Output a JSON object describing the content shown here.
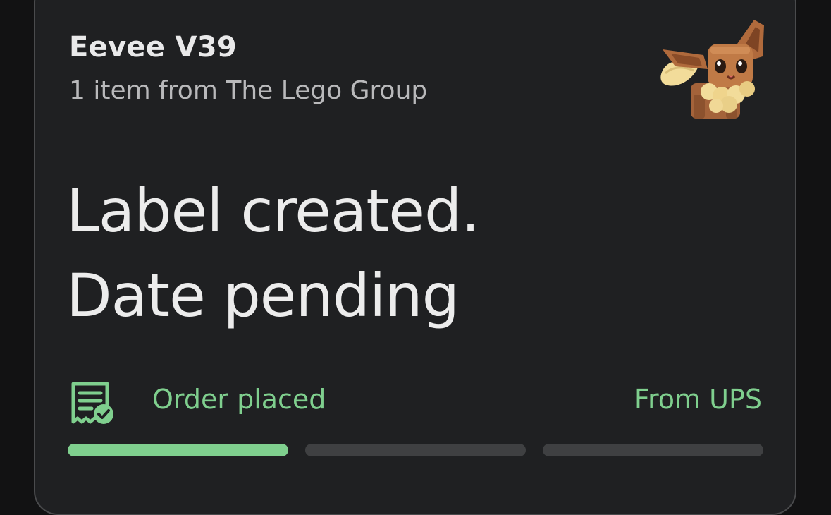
{
  "order": {
    "title": "Eevee V39",
    "subtitle": "1 item from The Lego Group",
    "product_image": "eevee-lego-figure-image"
  },
  "status": {
    "line1": "Label created.",
    "line2": "Date pending"
  },
  "tracking": {
    "step_icon": "receipt-check-icon",
    "step_label": "Order placed",
    "carrier": "From UPS",
    "segments": [
      {
        "progress": 1
      },
      {
        "progress": 0
      },
      {
        "progress": 0
      }
    ]
  },
  "colors": {
    "accent": "#7fcf8e",
    "card_bg": "#1f2022",
    "track_bg": "#3f4042"
  }
}
